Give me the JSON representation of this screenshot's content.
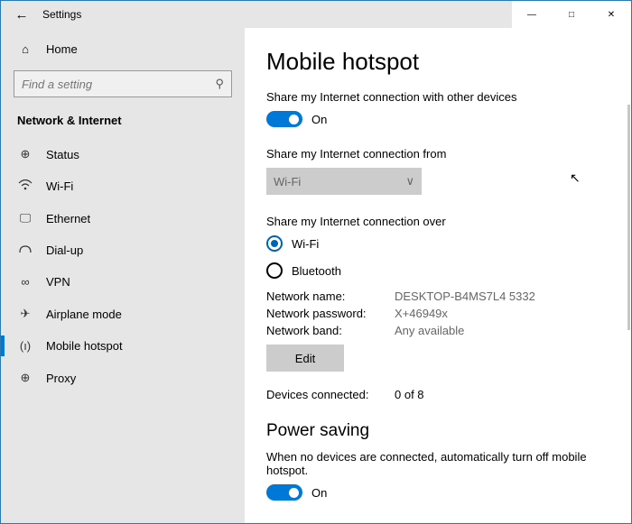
{
  "window": {
    "title": "Settings"
  },
  "sidebar": {
    "home": "Home",
    "search_placeholder": "Find a setting",
    "category": "Network & Internet",
    "items": [
      {
        "icon": "⊕",
        "label": "Status"
      },
      {
        "icon": "",
        "label": "Wi-Fi"
      },
      {
        "icon": "🖵",
        "label": "Ethernet"
      },
      {
        "icon": "",
        "label": "Dial-up"
      },
      {
        "icon": "∞",
        "label": "VPN"
      },
      {
        "icon": "✈",
        "label": "Airplane mode"
      },
      {
        "icon": "(ı)",
        "label": "Mobile hotspot"
      },
      {
        "icon": "⊕",
        "label": "Proxy"
      }
    ]
  },
  "main": {
    "title": "Mobile hotspot",
    "share_label": "Share my Internet connection with other devices",
    "toggle_state": "On",
    "from_label": "Share my Internet connection from",
    "from_value": "Wi-Fi",
    "over_label": "Share my Internet connection over",
    "over_wifi": "Wi-Fi",
    "over_bt": "Bluetooth",
    "net_name_k": "Network name:",
    "net_name_v": "DESKTOP-B4MS7L4 5332",
    "net_pass_k": "Network password:",
    "net_pass_v": "X+46949x",
    "net_band_k": "Network band:",
    "net_band_v": "Any available",
    "edit": "Edit",
    "devices_k": "Devices connected:",
    "devices_v": "0 of 8",
    "power_title": "Power saving",
    "power_label": "When no devices are connected, automatically turn off mobile hotspot.",
    "power_state": "On"
  }
}
